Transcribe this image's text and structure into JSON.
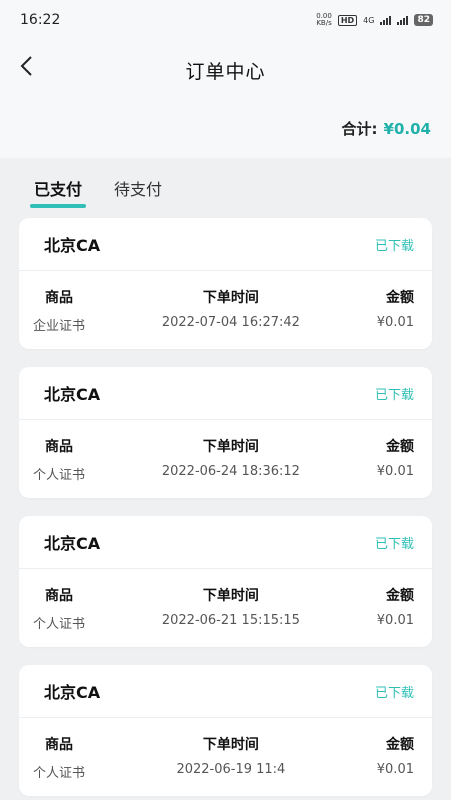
{
  "status": {
    "time": "16:22",
    "speed_value": "0.00",
    "speed_unit": "KB/s",
    "hd": "HD",
    "net": "4G",
    "battery": "82"
  },
  "nav": {
    "title": "订单中心"
  },
  "total": {
    "label": "合计:",
    "amount": "¥0.04"
  },
  "tabs": [
    {
      "label": "已支付",
      "active": true
    },
    {
      "label": "待支付",
      "active": false
    }
  ],
  "columns": {
    "product": "商品",
    "time": "下单时间",
    "amount": "金额"
  },
  "orders": [
    {
      "name": "北京CA",
      "status": "已下载",
      "product": "企业证书",
      "time": "2022-07-04 16:27:42",
      "amount": "¥0.01"
    },
    {
      "name": "北京CA",
      "status": "已下载",
      "product": "个人证书",
      "time": "2022-06-24 18:36:12",
      "amount": "¥0.01"
    },
    {
      "name": "北京CA",
      "status": "已下载",
      "product": "个人证书",
      "time": "2022-06-21 15:15:15",
      "amount": "¥0.01"
    },
    {
      "name": "北京CA",
      "status": "已下载",
      "product": "个人证书",
      "time": "2022-06-19 11:4",
      "amount": "¥0.01"
    }
  ]
}
